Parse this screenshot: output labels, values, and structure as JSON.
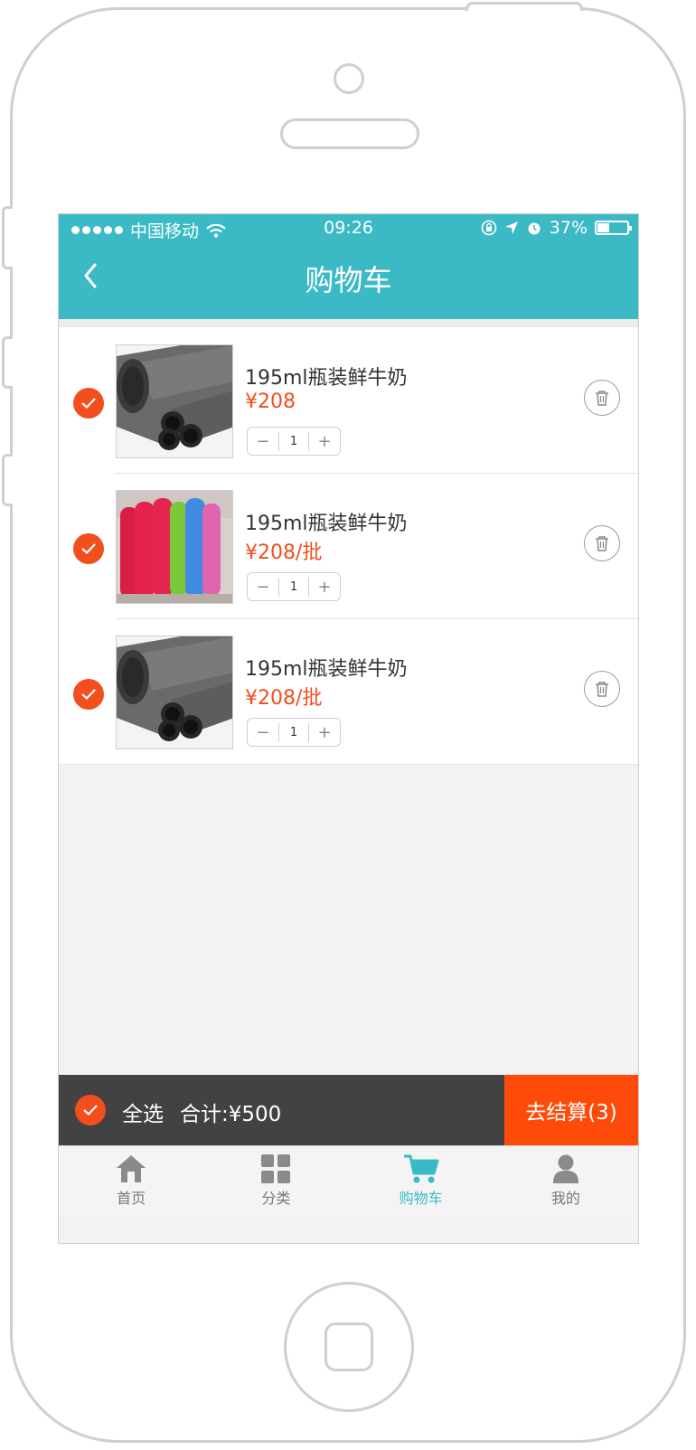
{
  "statusbar": {
    "carrier": "中国移动",
    "time": "09:26",
    "battery": "37%",
    "battery_level": 0.37
  },
  "header": {
    "title": "购物车"
  },
  "cart": {
    "items": [
      {
        "name": "195ml瓶装鲜牛奶",
        "price": "¥208",
        "quantity": "1",
        "selected": true,
        "image": "dark-foam-rolls"
      },
      {
        "name": "195ml瓶装鲜牛奶",
        "price": "¥208/批",
        "quantity": "1",
        "selected": true,
        "image": "colored-yoga-mats"
      },
      {
        "name": "195ml瓶装鲜牛奶",
        "price": "¥208/批",
        "quantity": "1",
        "selected": true,
        "image": "dark-foam-rolls"
      }
    ]
  },
  "checkout": {
    "select_all_label": "全选",
    "total_label": "合计:¥500",
    "checkout_label": "去结算(3)"
  },
  "tabbar": {
    "tabs": [
      {
        "label": "首页",
        "icon": "home-icon",
        "active": false
      },
      {
        "label": "分类",
        "icon": "grid-icon",
        "active": false
      },
      {
        "label": "购物车",
        "icon": "cart-icon",
        "active": true
      },
      {
        "label": "我的",
        "icon": "user-icon",
        "active": false
      }
    ]
  },
  "colors": {
    "accent": "#3bbac6",
    "price": "#f24e1e",
    "checkout": "#ff4b0a",
    "bar": "#424242"
  }
}
